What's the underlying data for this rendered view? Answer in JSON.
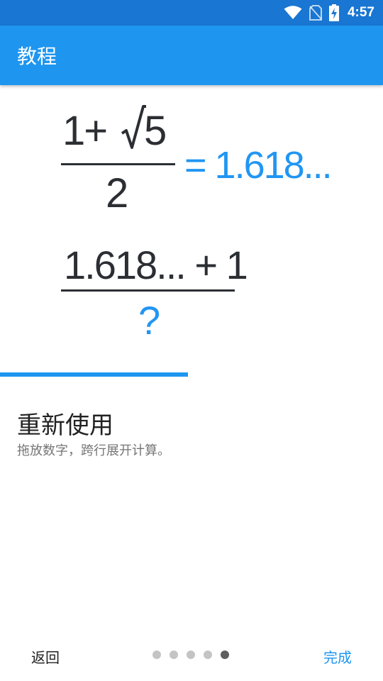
{
  "status_bar": {
    "time": "4:57",
    "icons": [
      "wifi-icon",
      "no-sim-icon",
      "battery-charging-icon"
    ]
  },
  "app_bar": {
    "title": "教程"
  },
  "illustration": {
    "formula1": {
      "numerator_prefix": "1+",
      "radicand": "5",
      "denominator": "2",
      "result": "= 1.618..."
    },
    "formula2": {
      "numerator": "1.618... + 1",
      "denominator": "?"
    }
  },
  "progress": {
    "fraction": 0.49
  },
  "content": {
    "heading": "重新使用",
    "body": "拖放数字，跨行展开计算。"
  },
  "nav": {
    "back_label": "返回",
    "done_label": "完成",
    "page_count": 5,
    "current_page": 5
  },
  "colors": {
    "status_bar": "#1976d2",
    "app_bar": "#1e96f0",
    "accent": "#2196f3",
    "formula_text": "#2b2e33"
  }
}
